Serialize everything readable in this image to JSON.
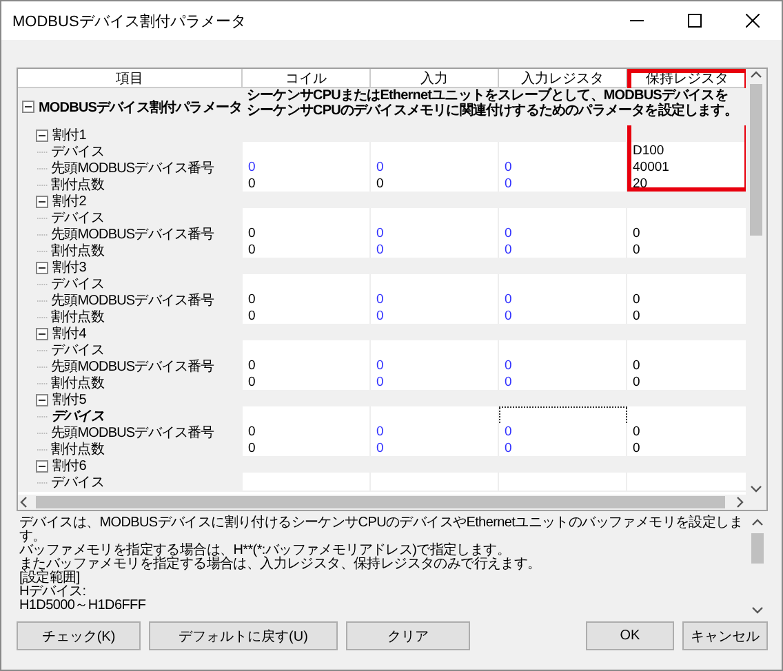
{
  "window": {
    "title": "MODBUSデバイス割付パラメータ"
  },
  "table": {
    "columns": [
      {
        "label": "項目",
        "highlighted": false
      },
      {
        "label": "コイル",
        "highlighted": false
      },
      {
        "label": "入力",
        "highlighted": false
      },
      {
        "label": "入力レジスタ",
        "highlighted": false
      },
      {
        "label": "保持レジスタ",
        "highlighted": true
      }
    ],
    "tree": [
      {
        "label": "MODBUSデバイス割付パラメータ",
        "expanded": true,
        "description": "シーケンサCPUまたはEthernetユニットをスレーブとして、MODBUSデバイスをシーケンサCPUのデバイスメモリに関連付けするためのパラメータを設定します。",
        "children": [
          {
            "label": "割付1",
            "expanded": true,
            "children": [
              {
                "label": "デバイス",
                "selected": false,
                "cells": [
                  {},
                  {},
                  {},
                  {
                    "text": "D100",
                    "color": "#000000"
                  }
                ]
              },
              {
                "label": "先頭MODBUSデバイス番号",
                "selected": false,
                "cells": [
                  {
                    "text": "0",
                    "color": "#3333ff"
                  },
                  {
                    "text": "0",
                    "color": "#3333ff"
                  },
                  {
                    "text": "0",
                    "color": "#3333ff"
                  },
                  {
                    "text": "40001",
                    "color": "#000000"
                  }
                ]
              },
              {
                "label": "割付点数",
                "selected": false,
                "cells": [
                  {
                    "text": "0",
                    "color": "#000000"
                  },
                  {
                    "text": "0",
                    "color": "#000000"
                  },
                  {
                    "text": "0",
                    "color": "#3333ff"
                  },
                  {
                    "text": "20",
                    "color": "#000000"
                  }
                ]
              }
            ]
          },
          {
            "label": "割付2",
            "expanded": true,
            "children": [
              {
                "label": "デバイス",
                "selected": false,
                "cells": [
                  {},
                  {},
                  {},
                  {}
                ]
              },
              {
                "label": "先頭MODBUSデバイス番号",
                "selected": false,
                "cells": [
                  {
                    "text": "0",
                    "color": "#000000"
                  },
                  {
                    "text": "0",
                    "color": "#3333ff"
                  },
                  {
                    "text": "0",
                    "color": "#3333ff"
                  },
                  {
                    "text": "0",
                    "color": "#000000"
                  }
                ]
              },
              {
                "label": "割付点数",
                "selected": false,
                "cells": [
                  {
                    "text": "0",
                    "color": "#000000"
                  },
                  {
                    "text": "0",
                    "color": "#3333ff"
                  },
                  {
                    "text": "0",
                    "color": "#3333ff"
                  },
                  {
                    "text": "0",
                    "color": "#000000"
                  }
                ]
              }
            ]
          },
          {
            "label": "割付3",
            "expanded": true,
            "children": [
              {
                "label": "デバイス",
                "selected": false,
                "cells": [
                  {},
                  {},
                  {},
                  {}
                ]
              },
              {
                "label": "先頭MODBUSデバイス番号",
                "selected": false,
                "cells": [
                  {
                    "text": "0",
                    "color": "#000000"
                  },
                  {
                    "text": "0",
                    "color": "#3333ff"
                  },
                  {
                    "text": "0",
                    "color": "#3333ff"
                  },
                  {
                    "text": "0",
                    "color": "#000000"
                  }
                ]
              },
              {
                "label": "割付点数",
                "selected": false,
                "cells": [
                  {
                    "text": "0",
                    "color": "#000000"
                  },
                  {
                    "text": "0",
                    "color": "#3333ff"
                  },
                  {
                    "text": "0",
                    "color": "#3333ff"
                  },
                  {
                    "text": "0",
                    "color": "#000000"
                  }
                ]
              }
            ]
          },
          {
            "label": "割付4",
            "expanded": true,
            "children": [
              {
                "label": "デバイス",
                "selected": false,
                "cells": [
                  {},
                  {},
                  {},
                  {}
                ]
              },
              {
                "label": "先頭MODBUSデバイス番号",
                "selected": false,
                "cells": [
                  {
                    "text": "0",
                    "color": "#000000"
                  },
                  {
                    "text": "0",
                    "color": "#3333ff"
                  },
                  {
                    "text": "0",
                    "color": "#3333ff"
                  },
                  {
                    "text": "0",
                    "color": "#000000"
                  }
                ]
              },
              {
                "label": "割付点数",
                "selected": false,
                "cells": [
                  {
                    "text": "0",
                    "color": "#000000"
                  },
                  {
                    "text": "0",
                    "color": "#3333ff"
                  },
                  {
                    "text": "0",
                    "color": "#3333ff"
                  },
                  {
                    "text": "0",
                    "color": "#000000"
                  }
                ]
              }
            ]
          },
          {
            "label": "割付5",
            "expanded": true,
            "children": [
              {
                "label": "デバイス",
                "selected": true,
                "cells": [
                  {},
                  {},
                  {
                    "focused": true
                  },
                  {}
                ]
              },
              {
                "label": "先頭MODBUSデバイス番号",
                "selected": false,
                "cells": [
                  {
                    "text": "0",
                    "color": "#000000"
                  },
                  {
                    "text": "0",
                    "color": "#3333ff"
                  },
                  {
                    "text": "0",
                    "color": "#3333ff"
                  },
                  {
                    "text": "0",
                    "color": "#000000"
                  }
                ]
              },
              {
                "label": "割付点数",
                "selected": false,
                "cells": [
                  {
                    "text": "0",
                    "color": "#000000"
                  },
                  {
                    "text": "0",
                    "color": "#3333ff"
                  },
                  {
                    "text": "0",
                    "color": "#3333ff"
                  },
                  {
                    "text": "0",
                    "color": "#000000"
                  }
                ]
              }
            ]
          },
          {
            "label": "割付6",
            "expanded": true,
            "children": [
              {
                "label": "デバイス",
                "selected": false,
                "cells": [
                  {},
                  {},
                  {},
                  {}
                ]
              }
            ]
          }
        ]
      }
    ]
  },
  "help": {
    "lines": [
      "デバイスは、MODBUSデバイスに割り付けるシーケンサCPUのデバイスやEthernetユニットのバッファメモリを設定します。",
      "バッファメモリを指定する場合は、H**(*:バッファメモリアドレス)で指定します。",
      "またバッファメモリを指定する場合は、入力レジスタ、保持レジスタのみで行えます。",
      "[設定範囲]",
      "Hデバイス:",
      "H1D5000～H1D6FFF"
    ]
  },
  "buttons": {
    "left": [
      "チェック(K)",
      "デフォルトに戻す(U)",
      "クリア"
    ],
    "right": [
      "OK",
      "キャンセル"
    ]
  }
}
